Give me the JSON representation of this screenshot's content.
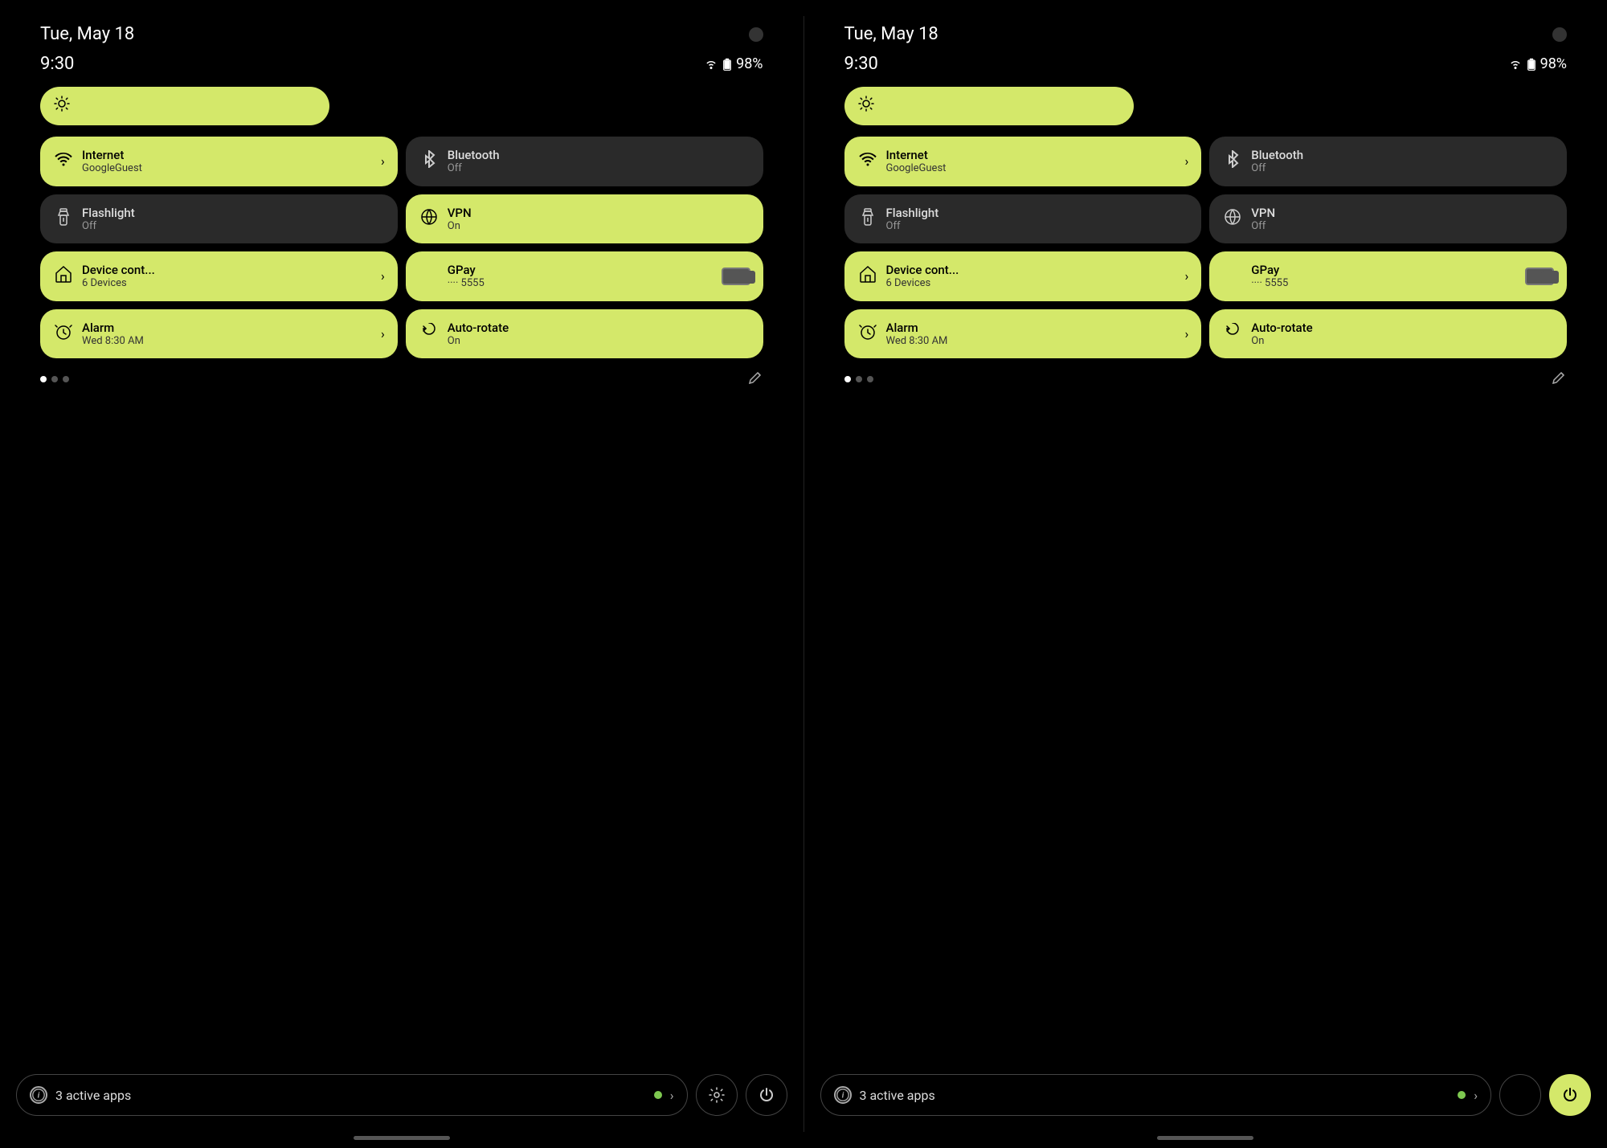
{
  "screens": [
    {
      "id": "screen-left",
      "status_bar": {
        "date": "Tue, May 18",
        "time": "9:30",
        "battery": "98%"
      },
      "tiles": [
        {
          "id": "internet",
          "title": "Internet",
          "subtitle": "GoogleGuest",
          "state": "active",
          "has_chevron": true,
          "icon": "wifi"
        },
        {
          "id": "bluetooth",
          "title": "Bluetooth",
          "subtitle": "Off",
          "state": "inactive",
          "has_chevron": false,
          "icon": "bluetooth"
        },
        {
          "id": "flashlight",
          "title": "Flashlight",
          "subtitle": "Off",
          "state": "inactive",
          "has_chevron": false,
          "icon": "flashlight"
        },
        {
          "id": "vpn",
          "title": "VPN",
          "subtitle": "On",
          "state": "active",
          "has_chevron": false,
          "icon": "vpn"
        },
        {
          "id": "device-control",
          "title": "Device cont...",
          "subtitle": "6 Devices",
          "state": "active",
          "has_chevron": true,
          "icon": "home"
        },
        {
          "id": "gpay",
          "title": "GPay",
          "subtitle": "···· 5555",
          "state": "active",
          "has_chevron": false,
          "icon": "gpay"
        },
        {
          "id": "alarm",
          "title": "Alarm",
          "subtitle": "Wed 8:30 AM",
          "state": "active",
          "has_chevron": true,
          "icon": "alarm"
        },
        {
          "id": "auto-rotate",
          "title": "Auto-rotate",
          "subtitle": "On",
          "state": "active",
          "has_chevron": false,
          "icon": "rotate"
        }
      ],
      "dots": [
        {
          "active": true
        },
        {
          "active": false
        },
        {
          "active": false
        }
      ],
      "bottom_bar": {
        "active_apps_count": "3",
        "active_apps_label": "active apps"
      }
    },
    {
      "id": "screen-right",
      "status_bar": {
        "date": "Tue, May 18",
        "time": "9:30",
        "battery": "98%"
      },
      "tiles": [
        {
          "id": "internet",
          "title": "Internet",
          "subtitle": "GoogleGuest",
          "state": "active",
          "has_chevron": true,
          "icon": "wifi"
        },
        {
          "id": "bluetooth",
          "title": "Bluetooth",
          "subtitle": "Off",
          "state": "inactive",
          "has_chevron": false,
          "icon": "bluetooth"
        },
        {
          "id": "flashlight",
          "title": "Flashlight",
          "subtitle": "Off",
          "state": "inactive",
          "has_chevron": false,
          "icon": "flashlight"
        },
        {
          "id": "vpn",
          "title": "VPN",
          "subtitle": "Off",
          "state": "inactive",
          "has_chevron": false,
          "icon": "vpn"
        },
        {
          "id": "device-control",
          "title": "Device cont...",
          "subtitle": "6 Devices",
          "state": "active",
          "has_chevron": true,
          "icon": "home"
        },
        {
          "id": "gpay",
          "title": "GPay",
          "subtitle": "···· 5555",
          "state": "active",
          "has_chevron": false,
          "icon": "gpay"
        },
        {
          "id": "alarm",
          "title": "Alarm",
          "subtitle": "Wed 8:30 AM",
          "state": "active",
          "has_chevron": true,
          "icon": "alarm"
        },
        {
          "id": "auto-rotate",
          "title": "Auto-rotate",
          "subtitle": "On",
          "state": "active",
          "has_chevron": false,
          "icon": "rotate"
        }
      ],
      "dots": [
        {
          "active": true
        },
        {
          "active": false
        },
        {
          "active": false
        }
      ],
      "bottom_bar": {
        "active_apps_count": "3",
        "active_apps_label": "active apps"
      }
    }
  ],
  "icons": {
    "wifi": "▼",
    "bluetooth": "✱",
    "flashlight": "▒",
    "vpn": "◉",
    "home": "⌂",
    "gpay": "▬",
    "alarm": "◷",
    "rotate": "↻",
    "gear": "⚙",
    "power": "⏻",
    "edit": "✎",
    "info": "i",
    "battery": "🔋",
    "signal": "▲"
  }
}
